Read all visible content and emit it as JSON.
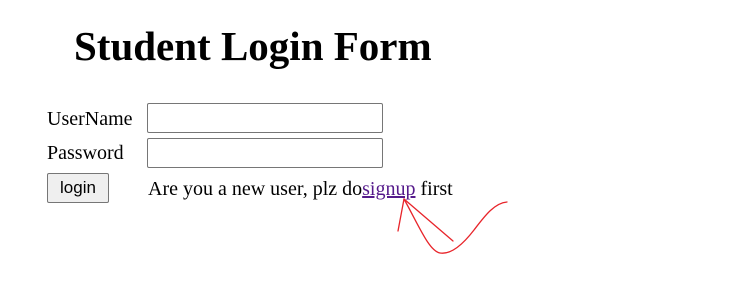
{
  "page": {
    "title": "Student Login Form"
  },
  "form": {
    "username_label": "UserName",
    "username_value": "",
    "password_label": "Password",
    "password_value": "",
    "login_label": "login",
    "signup_prefix": "Are you a new user, plz do",
    "signup_link": "signup",
    "signup_suffix": " first"
  },
  "colors": {
    "visited_link": "#551a8b",
    "annotation_stroke": "#e8242a"
  }
}
